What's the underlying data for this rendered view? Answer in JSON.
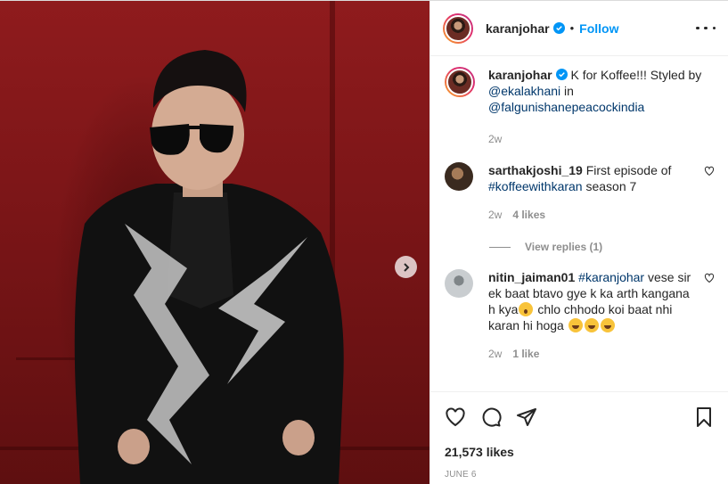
{
  "post": {
    "username": "karanjohar",
    "follow_label": "Follow",
    "separator": "•"
  },
  "caption": {
    "username": "karanjohar",
    "text": " K for Koffee!!! Styled by ",
    "mention1": "@ekalakhani",
    "text2": " in",
    "mention2": "@falgunishanepeacockindia",
    "time": "2w"
  },
  "comments": [
    {
      "username": "sarthakjoshi_19",
      "text": " First episode of ",
      "hashtag": "#koffeewithkaran",
      "text2": " season 7",
      "time": "2w",
      "likes": "4 likes",
      "view_replies": "View replies (1)"
    },
    {
      "username": "nitin_jaiman01",
      "hashtag": "#karanjohar",
      "text": " vese sir ek baat btavo gye k ka arth kangana h kya",
      "text2": " chlo chhodo koi baat nhi karan hi hoga ",
      "time": "2w",
      "likes": "1 like"
    }
  ],
  "footer": {
    "likes": "21,573 likes",
    "date": "JUNE 6"
  },
  "icons": {
    "verified": "verified-badge-icon",
    "more": "more-options-icon",
    "like": "heart-icon",
    "comment": "comment-icon",
    "share": "share-icon",
    "save": "bookmark-icon",
    "next": "chevron-right-icon"
  },
  "colors": {
    "accent": "#0095f6",
    "link": "#00376b",
    "muted": "#8e8e8e",
    "photo_bg": "#8f1b1d"
  }
}
